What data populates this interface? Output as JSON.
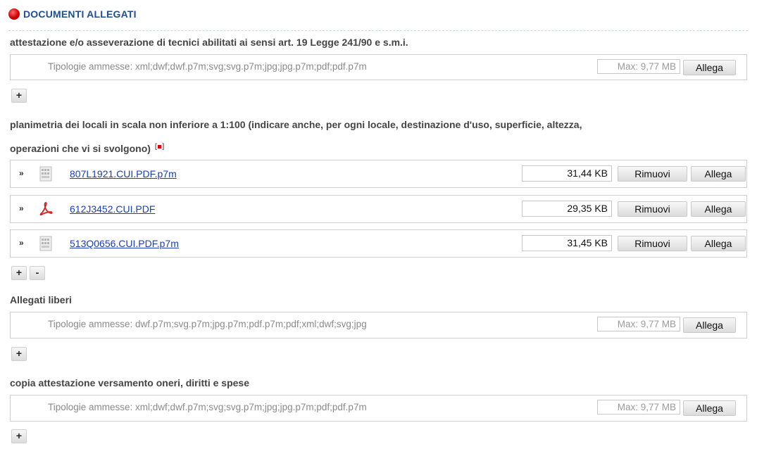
{
  "section": {
    "title": "DOCUMENTI ALLEGATI"
  },
  "groups": [
    {
      "label": "attestazione e/o asseverazione di tecnici abilitati ai sensi art. 19 Legge 241/90 e s.m.i.",
      "types": "Tipologie ammesse: xml;dwf;dwf.p7m;svg;svg.p7m;jpg;jpg.p7m;pdf;pdf.p7m",
      "max": "Max: 9,77 MB",
      "attach_label": "Allega",
      "add_label": "+"
    },
    {
      "label_line1": "planimetria dei locali in scala non inferiore a 1:100 (indicare anche, per ogni locale, destinazione d'uso, superficie, altezza,",
      "label_line2": "operazioni che vi si svolgono)",
      "files": [
        {
          "name": "807L1921.CUI.PDF.p7m",
          "size": "31,44 KB",
          "icon": "signed-file-icon",
          "remove_label": "Rimuovi",
          "attach_label": "Allega"
        },
        {
          "name": "612J3452.CUI.PDF",
          "size": "29,35 KB",
          "icon": "pdf-icon",
          "remove_label": "Rimuovi",
          "attach_label": "Allega"
        },
        {
          "name": "513Q0656.CUI.PDF.p7m",
          "size": "31,45 KB",
          "icon": "signed-file-icon",
          "remove_label": "Rimuovi",
          "attach_label": "Allega"
        }
      ],
      "add_label": "+",
      "remove_group_label": "-"
    },
    {
      "label": "Allegati liberi",
      "types": "Tipologie ammesse: dwf.p7m;svg.p7m;jpg.p7m;pdf.p7m;pdf;xml;dwf;svg;jpg",
      "max": "Max: 9,77 MB",
      "attach_label": "Allega",
      "add_label": "+"
    },
    {
      "label": "copia attestazione versamento oneri, diritti e spese",
      "types": "Tipologie ammesse: xml;dwf;dwf.p7m;svg;svg.p7m;jpg;jpg.p7m;pdf;pdf.p7m",
      "max": "Max: 9,77 MB",
      "attach_label": "Allega",
      "add_label": "+"
    }
  ],
  "colors": {
    "header_title": "#1d4f91",
    "link": "#1a3db8",
    "required_marker": "#e00000"
  }
}
